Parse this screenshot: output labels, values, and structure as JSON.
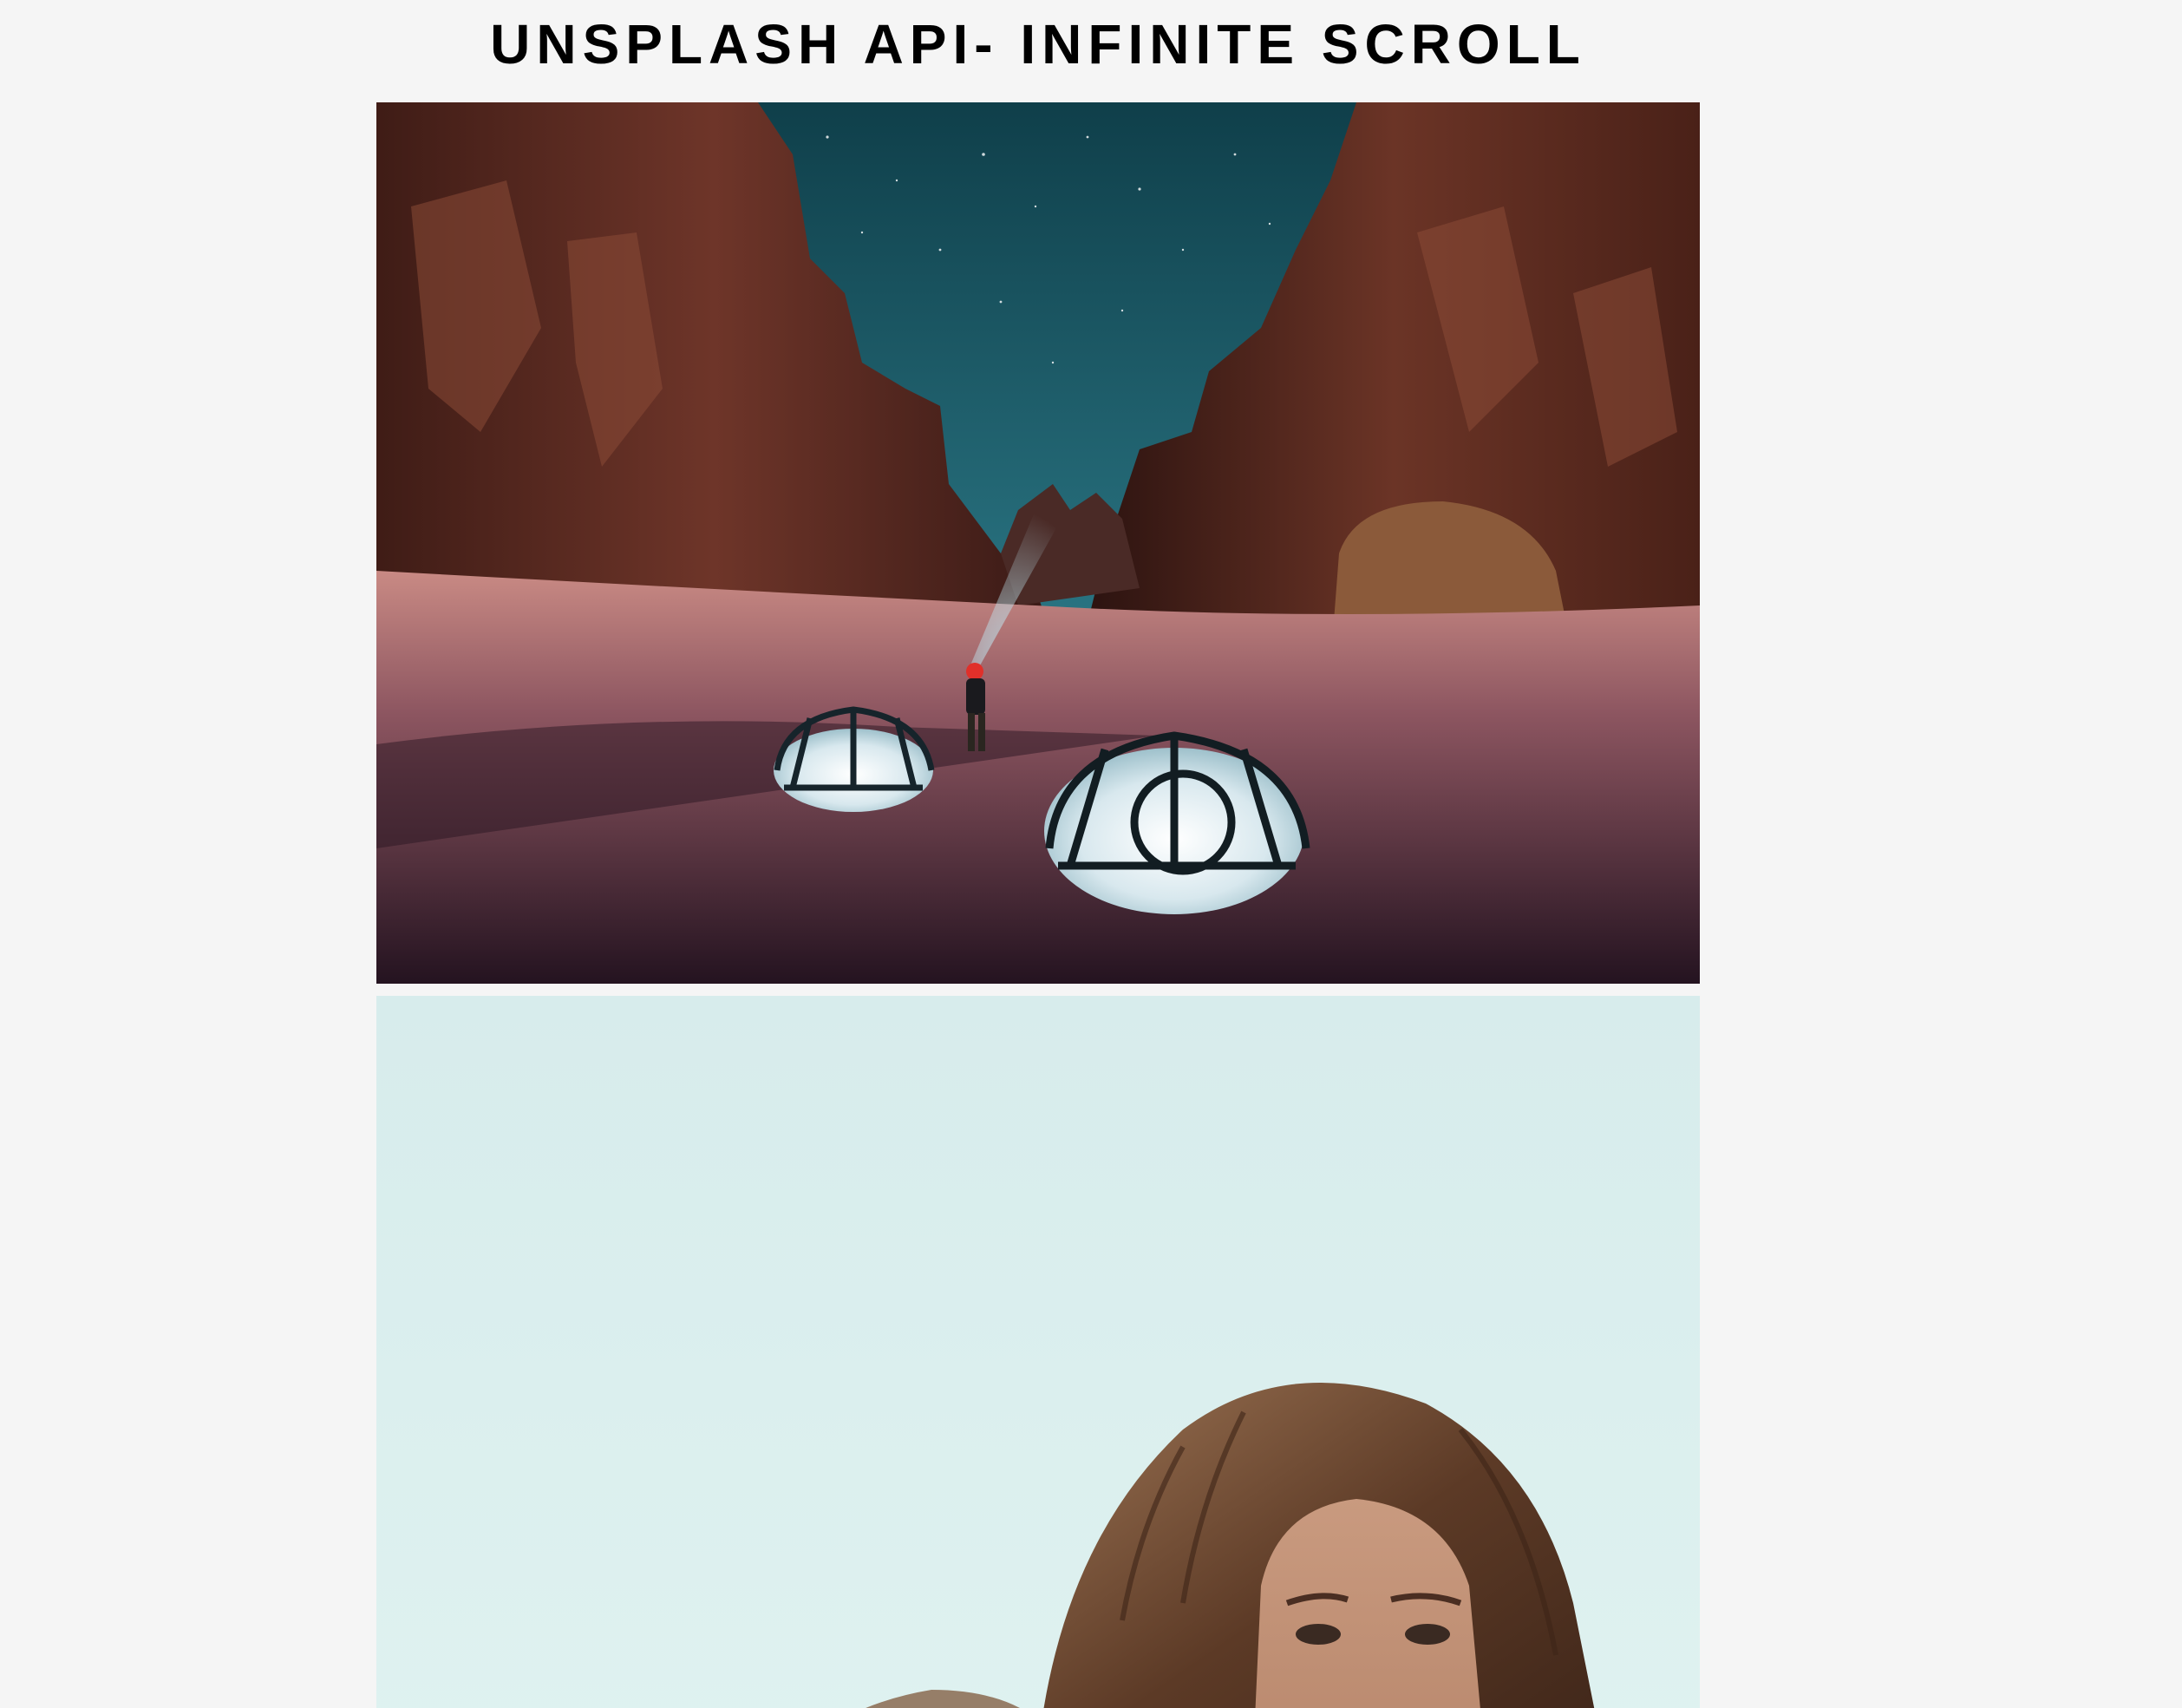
{
  "page": {
    "title": "UNSPLASH API- INFINITE SCROLL",
    "background_color": "#f5f5f5"
  },
  "gallery": {
    "photos": [
      {
        "subject": "desert-canyon-night-camp",
        "colors": {
          "sky": "#1d5f6b",
          "rock": "#6a3328",
          "sand": "#b8757a",
          "tent_glow": "#e7f1f4"
        }
      },
      {
        "subject": "woman-portrait-pale-sky",
        "colors": {
          "sky": "#dcefee",
          "hair": "#6a4630",
          "skin": "#c89a7e"
        }
      }
    ]
  }
}
